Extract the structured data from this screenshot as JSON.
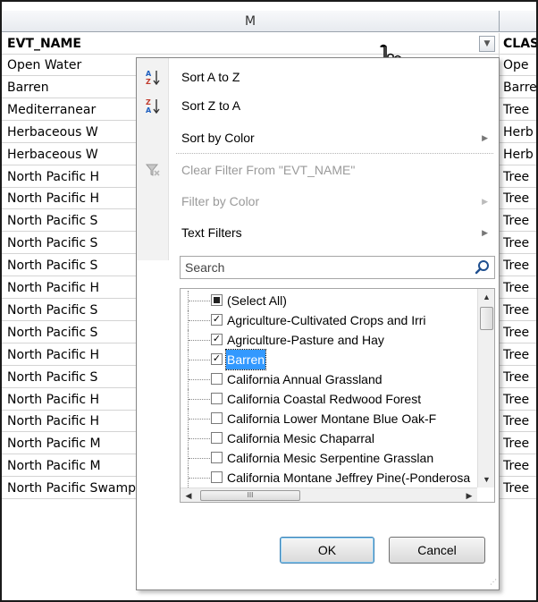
{
  "sheet": {
    "column_headers": [
      "M",
      ""
    ],
    "header_row": {
      "col_m": "EVT_NAME",
      "col_n": "CLAS"
    },
    "rows": [
      {
        "col_m": "Open Water",
        "col_n": "Ope"
      },
      {
        "col_m": "Barren",
        "col_n": "Barre"
      },
      {
        "col_m": "Mediterranear",
        "col_n": "Tree"
      },
      {
        "col_m": "Herbaceous W",
        "col_n": "Herb"
      },
      {
        "col_m": "Herbaceous W",
        "col_n": "Herb"
      },
      {
        "col_m": "North Pacific H",
        "col_n": "Tree"
      },
      {
        "col_m": "North Pacific H",
        "col_n": "Tree"
      },
      {
        "col_m": "North Pacific S",
        "col_n": "Tree"
      },
      {
        "col_m": "North Pacific S",
        "col_n": "Tree"
      },
      {
        "col_m": "North Pacific S",
        "col_n": "Tree"
      },
      {
        "col_m": "North Pacific H",
        "col_n": "Tree"
      },
      {
        "col_m": "North Pacific S",
        "col_n": "Tree"
      },
      {
        "col_m": "North Pacific S",
        "col_n": "Tree"
      },
      {
        "col_m": "North Pacific H",
        "col_n": "Tree"
      },
      {
        "col_m": "North Pacific S",
        "col_n": "Tree"
      },
      {
        "col_m": "North Pacific H",
        "col_n": "Tree"
      },
      {
        "col_m": "North Pacific H",
        "col_n": "Tree"
      },
      {
        "col_m": "North Pacific M",
        "col_n": "Tree"
      },
      {
        "col_m": "North Pacific M",
        "col_n": "Tree"
      },
      {
        "col_m": "North Pacific Swamp Systems",
        "col_n": "Tree"
      }
    ]
  },
  "filter_menu": {
    "items": {
      "sort_az": "Sort A to Z",
      "sort_za": "Sort Z to A",
      "sort_by_color": "Sort by Color",
      "clear_filter": "Clear Filter From \"EVT_NAME\"",
      "filter_by_color": "Filter by Color",
      "text_filters": "Text Filters"
    },
    "icons": {
      "sort_az": "sort-ascending-icon",
      "sort_za": "sort-descending-icon",
      "clear_filter": "clear-filter-icon",
      "search": "search-icon",
      "dropdown": "filter-dropdown-icon"
    },
    "search_placeholder": "Search",
    "list": [
      {
        "label": "(Select All)",
        "state": "partial"
      },
      {
        "label": "Agriculture-Cultivated Crops and Irri",
        "state": "checked"
      },
      {
        "label": "Agriculture-Pasture and Hay",
        "state": "checked"
      },
      {
        "label": "Barren",
        "state": "checked",
        "selected": true
      },
      {
        "label": "California Annual Grassland",
        "state": "unchecked"
      },
      {
        "label": "California Coastal Redwood Forest",
        "state": "unchecked"
      },
      {
        "label": "California Lower Montane Blue Oak-F",
        "state": "unchecked"
      },
      {
        "label": "California Mesic Chaparral",
        "state": "unchecked"
      },
      {
        "label": "California Mesic Serpentine Grasslan",
        "state": "unchecked"
      },
      {
        "label": "California Montane Jeffrey Pine(-Ponderosa",
        "state": "unchecked"
      }
    ],
    "ok_label": "OK",
    "cancel_label": "Cancel"
  },
  "colors": {
    "selection": "#3399ff",
    "ok_border": "#3c7fb1"
  }
}
